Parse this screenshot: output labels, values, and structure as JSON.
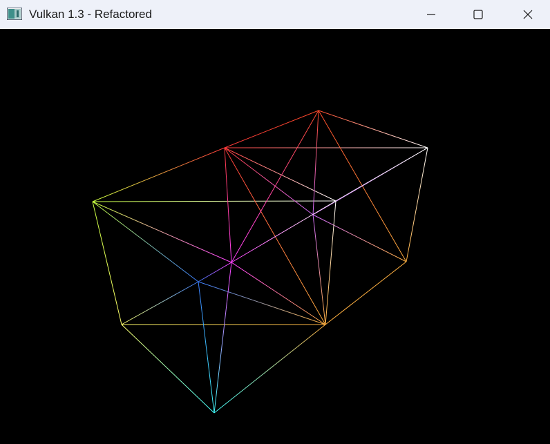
{
  "window": {
    "title": "Vulkan 1.3 - Refactored",
    "icon": "vulkan-app-icon",
    "controls": {
      "minimize": "minimize-icon",
      "maximize": "maximize-icon",
      "close": "close-icon"
    }
  },
  "render": {
    "background_color": "#000000",
    "description_kind": "wireframe-mesh"
  }
}
